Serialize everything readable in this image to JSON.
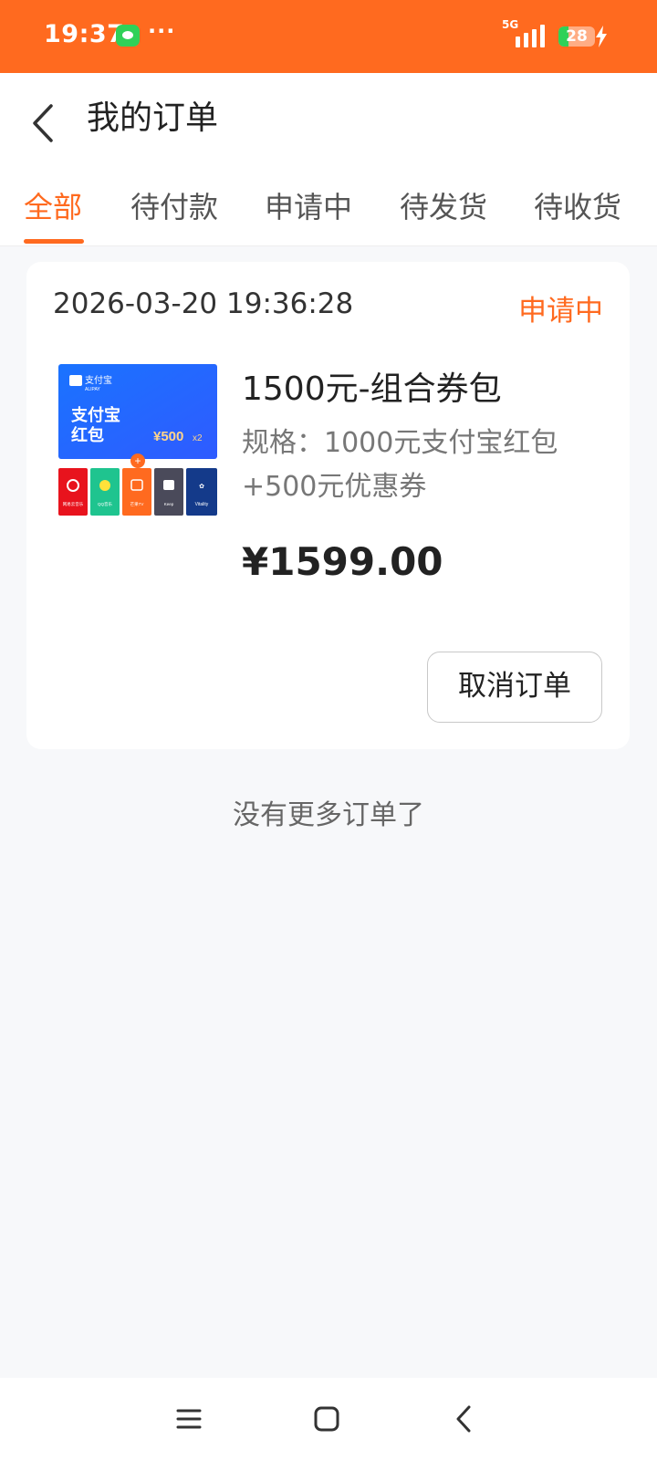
{
  "status_bar": {
    "time": "19:37",
    "dots": "···",
    "network": "5G",
    "battery": 28,
    "battery_text": "28",
    "icons": [
      "message-icon",
      "signal-icon",
      "battery-icon",
      "charging-icon"
    ]
  },
  "header": {
    "title": "我的订单",
    "back_icon": "chevron-left-icon"
  },
  "tabs": [
    {
      "label": "全部",
      "active": true
    },
    {
      "label": "待付款",
      "active": false
    },
    {
      "label": "申请中",
      "active": false
    },
    {
      "label": "待发货",
      "active": false
    },
    {
      "label": "待收货",
      "active": false
    }
  ],
  "order": {
    "time": "2026-03-20 19:36:28",
    "status": "申请中",
    "product": {
      "name": "1500元-组合券包",
      "spec": "规格：1000元支付宝红包+500元优惠券",
      "price": "¥1599.00",
      "image": {
        "brand": "支付宝",
        "brand_en": "ALIPAY",
        "title_line1": "支付宝",
        "title_line2": "红包",
        "amount": "¥500",
        "multiplier": "x2",
        "plus": "+",
        "apps": [
          "网易云音乐",
          "QQ音乐",
          "芒果TV",
          "Keep",
          "Vitality"
        ]
      }
    },
    "cancel_label": "取消订单"
  },
  "footer_text": "没有更多订单了",
  "colors": {
    "accent": "#ff6a1f",
    "background": "#f7f8fa",
    "alipay_blue": "#1677ff"
  },
  "system_nav": [
    "menu-icon",
    "home-icon",
    "back-icon"
  ]
}
